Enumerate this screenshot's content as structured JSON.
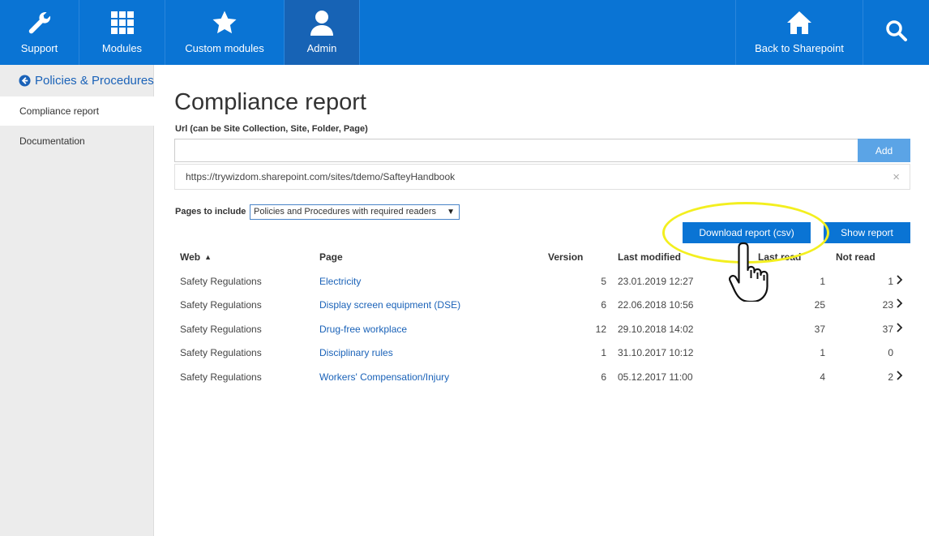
{
  "nav": {
    "items": [
      {
        "label": "Support",
        "icon": "wrench-icon"
      },
      {
        "label": "Modules",
        "icon": "grid-icon"
      },
      {
        "label": "Custom modules",
        "icon": "star-icon"
      },
      {
        "label": "Admin",
        "icon": "user-icon"
      },
      {
        "label": "Back to Sharepoint",
        "icon": "home-icon"
      }
    ],
    "search_icon": "search-icon",
    "active": "Admin"
  },
  "sidebar": {
    "title": "Policies & Procedures",
    "items": [
      {
        "label": "Compliance report",
        "active": true
      },
      {
        "label": "Documentation",
        "active": false
      }
    ]
  },
  "main": {
    "title": "Compliance report",
    "url_label": "Url (can be Site Collection, Site, Folder, Page)",
    "url_input_value": "",
    "add_label": "Add",
    "url_entries": [
      "https://trywizdom.sharepoint.com/sites/tdemo/SafteyHandbook"
    ],
    "remove_icon": "×",
    "pages_label": "Pages to include",
    "pages_selected": "Policies and Procedures with required readers",
    "download_label": "Download report (csv)",
    "show_label": "Show report"
  },
  "table": {
    "headers": {
      "web": "Web",
      "page": "Page",
      "version": "Version",
      "last_modified": "Last modified",
      "last_read": "Last read",
      "not_read": "Not read"
    },
    "sort_column": "web",
    "rows": [
      {
        "web": "Safety Regulations",
        "page": "Electricity",
        "version": "5",
        "last_modified": "23.01.2019 12:27",
        "last_read": "1",
        "not_read": "1",
        "expandable": true
      },
      {
        "web": "Safety Regulations",
        "page": "Display screen equipment (DSE)",
        "version": "6",
        "last_modified": "22.06.2018 10:56",
        "last_read": "25",
        "not_read": "23",
        "expandable": true
      },
      {
        "web": "Safety Regulations",
        "page": "Drug-free workplace",
        "version": "12",
        "last_modified": "29.10.2018 14:02",
        "last_read": "37",
        "not_read": "37",
        "expandable": true
      },
      {
        "web": "Safety Regulations",
        "page": "Disciplinary rules",
        "version": "1",
        "last_modified": "31.10.2017 10:12",
        "last_read": "1",
        "not_read": "0",
        "expandable": false
      },
      {
        "web": "Safety Regulations",
        "page": "Workers' Compensation/Injury",
        "version": "6",
        "last_modified": "05.12.2017 11:00",
        "last_read": "4",
        "not_read": "2",
        "expandable": true
      }
    ]
  },
  "colors": {
    "primary": "#0a74d4",
    "primary_dark": "#1763b5",
    "link": "#1a62b8",
    "highlight": "#f3ef1f"
  }
}
